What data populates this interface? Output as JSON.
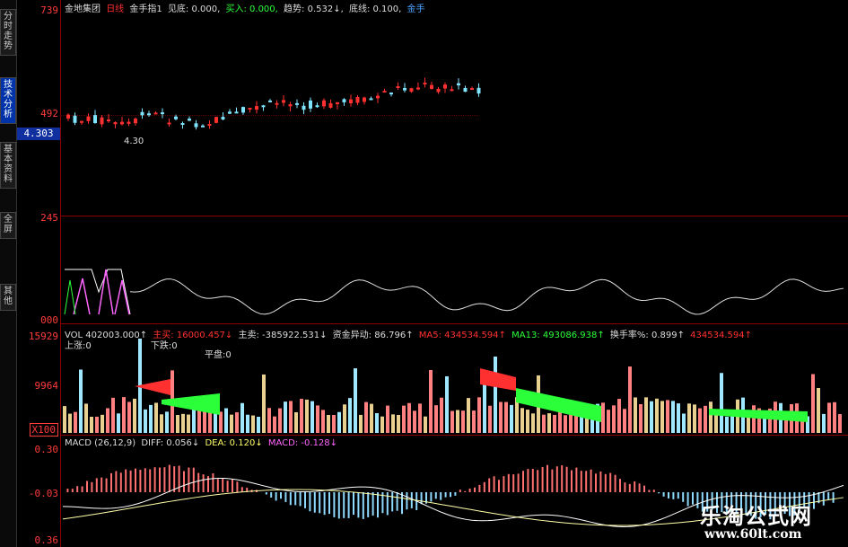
{
  "sidebar": {
    "tabs": [
      {
        "label": "分时走势",
        "active": false
      },
      {
        "label": "技术分析",
        "active": true
      },
      {
        "label": "基本资料",
        "active": false
      },
      {
        "label": "全屏",
        "active": false
      },
      {
        "label": "其他",
        "active": false
      }
    ]
  },
  "price_axis": {
    "top": "739",
    "mid": "492",
    "current": "4.303"
  },
  "osc_axis": {
    "top": "245",
    "bottom": "000"
  },
  "vol_axis": {
    "top": "15929",
    "mid": "9964",
    "unit": "X100"
  },
  "macd_axis": {
    "top": "0.30",
    "mid": "-0.03",
    "bottom": "0.36"
  },
  "header": {
    "stock_name": "金地集团",
    "period": "日线",
    "indicator": "金手指1",
    "item1": "见底: 0.000,",
    "item2": "买入: 0.000,",
    "item3": "趋势: 0.532↓,",
    "item4": "底线: 0.100,",
    "item5": "金手"
  },
  "low_marker": "4.30",
  "vol_header": {
    "vol": "VOL 402003.000↑",
    "main_buy": "主买: 16000.457↓",
    "main_sell": "主卖: -385922.531↓",
    "fund": "资金异动: 86.796↑",
    "ma5": "MA5: 434534.594↑",
    "ma13": "MA13: 493086.938↑",
    "turnover": "换手率%: 0.899↑",
    "ma_extra": "434534.594↑",
    "ma_extra2": "434534"
  },
  "vol_sub": {
    "up": "上涨:0",
    "down": "下跌:0",
    "flat": "平盘:0"
  },
  "macd_header": {
    "name": "MACD (26,12,9)",
    "diff": "DIFF: 0.056↓",
    "dea": "DEA: 0.120↓",
    "macd": "MACD: -0.128↓"
  },
  "watermark": {
    "main": "乐淘公式网",
    "url": "www.60lt.com"
  },
  "colors": {
    "up": "#ff3030",
    "down": "#00ffff",
    "frame": "#8b0000",
    "ma_green": "#2bff3a"
  }
}
